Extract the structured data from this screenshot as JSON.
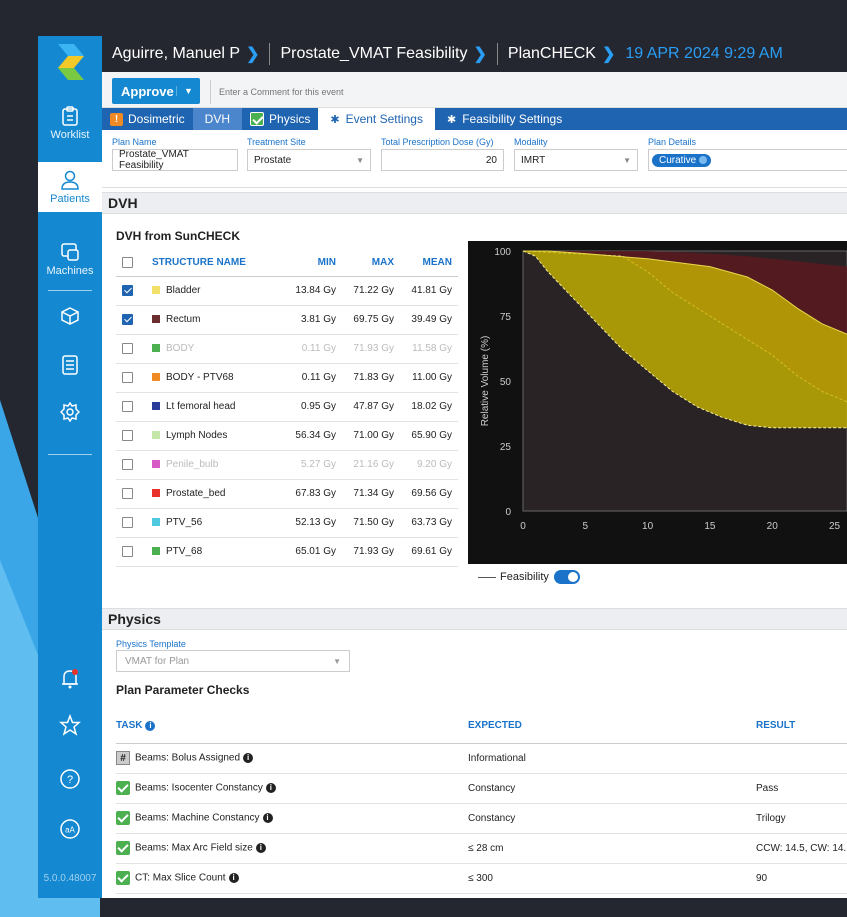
{
  "header": {
    "patient": "Aguirre, Manuel P",
    "plan": "Prostate_VMAT Feasibility",
    "module": "PlanCHECK",
    "datetime": "19 APR 2024 9:29 AM"
  },
  "sidebar": {
    "items": [
      {
        "label": "Worklist",
        "icon": "clipboard-icon"
      },
      {
        "label": "Patients",
        "icon": "person-icon"
      },
      {
        "label": "Machines",
        "icon": "machine-icon"
      },
      {
        "label": "",
        "icon": "cube-icon"
      },
      {
        "label": "",
        "icon": "document-icon"
      },
      {
        "label": "",
        "icon": "gear-icon"
      }
    ],
    "bottom_icons": [
      "bell-icon",
      "star-icon",
      "help-icon",
      "font-size-icon"
    ],
    "version": "5.0.0.48007"
  },
  "actions": {
    "approve_label": "Approve",
    "comment_placeholder": "Enter a Comment for this event"
  },
  "tabs": [
    "Dosimetric",
    "DVH",
    "Physics",
    "Event Settings",
    "Feasibility Settings"
  ],
  "fields": {
    "plan_name": {
      "label": "Plan Name",
      "value": "Prostate_VMAT Feasibility"
    },
    "treatment_site": {
      "label": "Treatment Site",
      "value": "Prostate"
    },
    "dose": {
      "label": "Total Prescription Dose (Gy)",
      "value": "20"
    },
    "modality": {
      "label": "Modality",
      "value": "IMRT"
    },
    "plan_details": {
      "label": "Plan Details",
      "value": "Curative"
    }
  },
  "dvh": {
    "section_title": "DVH",
    "subtitle": "DVH from SunCHECK",
    "columns": [
      "STRUCTURE NAME",
      "MIN",
      "MAX",
      "MEAN"
    ],
    "rows": [
      {
        "name": "Bladder",
        "min": "13.84 Gy",
        "max": "71.22 Gy",
        "mean": "41.81 Gy",
        "color": "#f2e06b",
        "checked": true,
        "dim": false
      },
      {
        "name": "Rectum",
        "min": "3.81 Gy",
        "max": "69.75 Gy",
        "mean": "39.49 Gy",
        "color": "#6b2d2d",
        "checked": true,
        "dim": false
      },
      {
        "name": "BODY",
        "min": "0.11 Gy",
        "max": "71.93 Gy",
        "mean": "11.58 Gy",
        "color": "#4caf50",
        "checked": false,
        "dim": true
      },
      {
        "name": "BODY - PTV68",
        "min": "0.11 Gy",
        "max": "71.83 Gy",
        "mean": "11.00 Gy",
        "color": "#f08a24",
        "checked": false,
        "dim": false
      },
      {
        "name": "Lt femoral head",
        "min": "0.95 Gy",
        "max": "47.87 Gy",
        "mean": "18.02 Gy",
        "color": "#2a3b9a",
        "checked": false,
        "dim": false
      },
      {
        "name": "Lymph Nodes",
        "min": "56.34 Gy",
        "max": "71.00 Gy",
        "mean": "65.90 Gy",
        "color": "#c4e6a8",
        "checked": false,
        "dim": false
      },
      {
        "name": "Penile_bulb",
        "min": "5.27 Gy",
        "max": "21.16 Gy",
        "mean": "9.20 Gy",
        "color": "#d65bc4",
        "checked": false,
        "dim": true
      },
      {
        "name": "Prostate_bed",
        "min": "67.83 Gy",
        "max": "71.34 Gy",
        "mean": "69.56 Gy",
        "color": "#e8332c",
        "checked": false,
        "dim": false
      },
      {
        "name": "PTV_56",
        "min": "52.13 Gy",
        "max": "71.50 Gy",
        "mean": "63.73 Gy",
        "color": "#4fc9e0",
        "checked": false,
        "dim": false
      },
      {
        "name": "PTV_68",
        "min": "65.01 Gy",
        "max": "71.93 Gy",
        "mean": "69.61 Gy",
        "color": "#4caf50",
        "checked": false,
        "dim": false
      }
    ],
    "legend": "Feasibility"
  },
  "chart_data": {
    "type": "area",
    "ylabel": "Relative Volume (%)",
    "xlabel": "",
    "xlim": [
      0,
      26
    ],
    "ylim": [
      0,
      100
    ],
    "x_ticks": [
      0,
      5,
      10,
      15,
      20,
      25
    ],
    "y_ticks": [
      0,
      25,
      50,
      75,
      100
    ],
    "series": [
      {
        "name": "Bladder",
        "color": "#c8b400",
        "upper": [
          [
            0,
            100
          ],
          [
            2,
            100
          ],
          [
            5,
            99
          ],
          [
            10,
            97
          ],
          [
            15,
            94
          ],
          [
            18,
            90
          ],
          [
            20,
            85
          ],
          [
            22,
            78
          ],
          [
            24,
            72
          ],
          [
            26,
            68
          ]
        ],
        "lower": [
          [
            0,
            100
          ],
          [
            1,
            98
          ],
          [
            2,
            92
          ],
          [
            4,
            82
          ],
          [
            6,
            72
          ],
          [
            8,
            62
          ],
          [
            10,
            54
          ],
          [
            12,
            46
          ],
          [
            14,
            40
          ],
          [
            16,
            36
          ],
          [
            18,
            33
          ],
          [
            20,
            32
          ],
          [
            26,
            32
          ]
        ]
      },
      {
        "name": "Rectum",
        "color": "#5a1a1f",
        "upper": [
          [
            0,
            100
          ],
          [
            10,
            100
          ],
          [
            15,
            99
          ],
          [
            18,
            98
          ],
          [
            20,
            97
          ],
          [
            22,
            96
          ],
          [
            24,
            95
          ],
          [
            26,
            94
          ]
        ],
        "lower": [
          [
            0,
            100
          ],
          [
            8,
            98
          ],
          [
            10,
            92
          ],
          [
            12,
            84
          ],
          [
            14,
            78
          ],
          [
            16,
            72
          ],
          [
            18,
            66
          ],
          [
            20,
            60
          ],
          [
            22,
            52
          ],
          [
            24,
            46
          ],
          [
            26,
            42
          ]
        ]
      }
    ]
  },
  "physics": {
    "section_title": "Physics",
    "template_label": "Physics Template",
    "template_value": "VMAT for Plan",
    "checks_title": "Plan Parameter Checks",
    "columns": [
      "TASK",
      "EXPECTED",
      "RESULT"
    ],
    "rows": [
      {
        "task": "Beams: Bolus Assigned",
        "expected": "Informational",
        "result": "",
        "status": "info"
      },
      {
        "task": "Beams: Isocenter Constancy",
        "expected": "Constancy",
        "result": "Pass",
        "status": "pass"
      },
      {
        "task": "Beams: Machine Constancy",
        "expected": "Constancy",
        "result": "Trilogy",
        "status": "pass"
      },
      {
        "task": "Beams: Max Arc Field size",
        "expected": "≤ 28 cm",
        "result": "CCW: 14.5, CW: 14.",
        "status": "pass"
      },
      {
        "task": "CT: Max Slice Count",
        "expected": "≤ 300",
        "result": "90",
        "status": "pass"
      }
    ]
  }
}
